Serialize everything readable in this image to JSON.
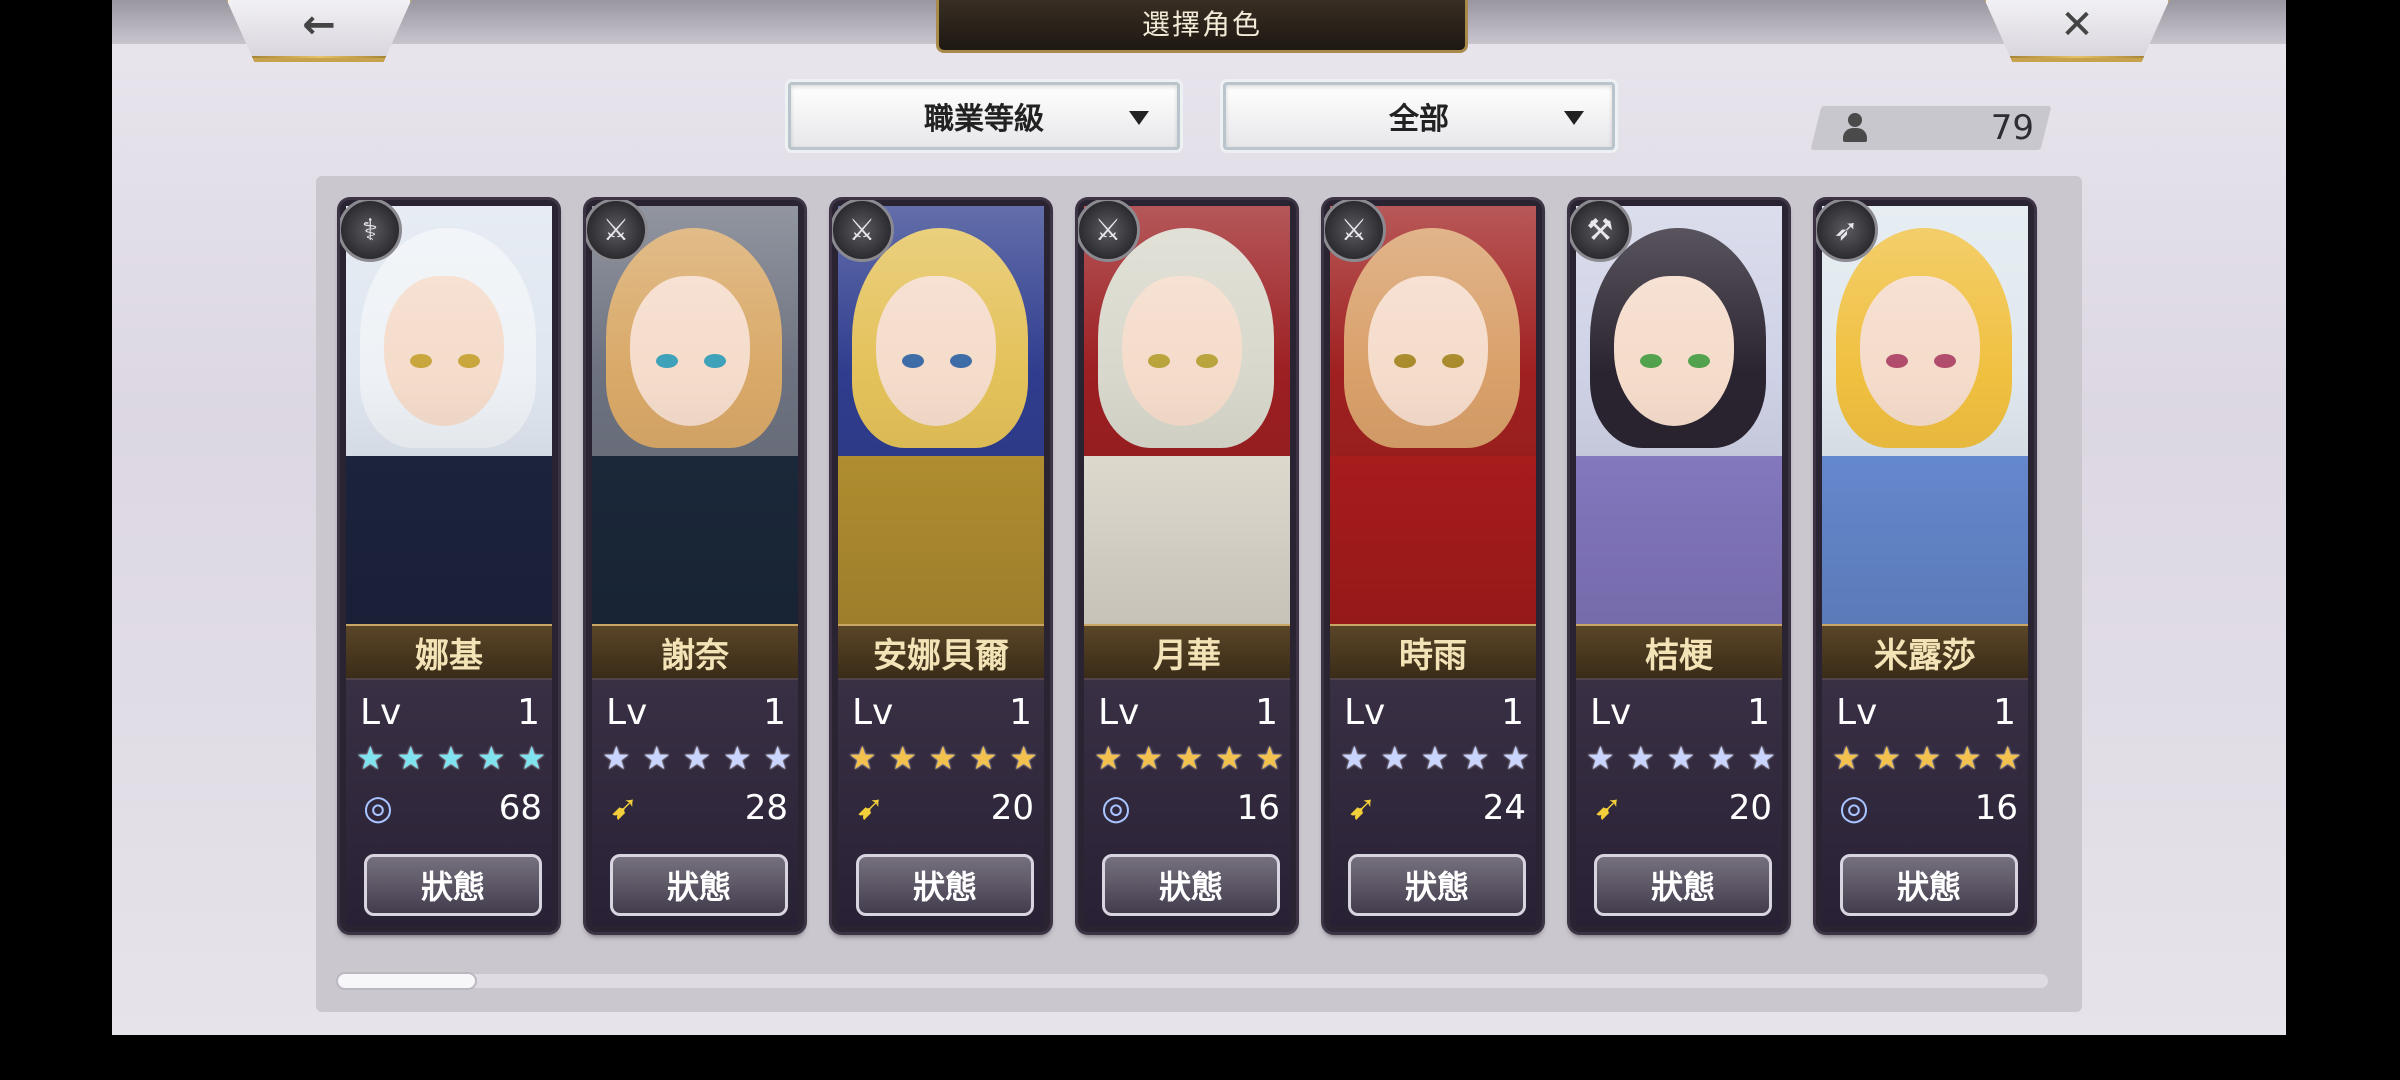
{
  "header": {
    "title": "選擇角色",
    "back_icon": "back-arrow-icon",
    "close_icon": "close-icon"
  },
  "filters": {
    "job_level": "職業等級",
    "category": "全部"
  },
  "roster_count": "79",
  "characters": [
    {
      "name": "娜基",
      "lv_label": "Lv",
      "lv": "1",
      "stars": 5,
      "star_color": "#7fe3f0",
      "element": "wind",
      "element_icon": "swirl-icon",
      "power": "68",
      "status": "狀態",
      "class_icon": "staff-icon"
    },
    {
      "name": "謝奈",
      "lv_label": "Lv",
      "lv": "1",
      "stars": 5,
      "star_color": "#c9d4ff",
      "element": "light",
      "element_icon": "wing-icon",
      "power": "28",
      "status": "狀態",
      "class_icon": "sword-icon"
    },
    {
      "name": "安娜貝爾",
      "lv_label": "Lv",
      "lv": "1",
      "stars": 5,
      "star_color": "#f2c14e",
      "element": "light",
      "element_icon": "wing-icon",
      "power": "20",
      "status": "狀態",
      "class_icon": "sword-icon"
    },
    {
      "name": "月華",
      "lv_label": "Lv",
      "lv": "1",
      "stars": 5,
      "star_color": "#f2c14e",
      "element": "wind",
      "element_icon": "swirl-icon",
      "power": "16",
      "status": "狀態",
      "class_icon": "katana-icon"
    },
    {
      "name": "時雨",
      "lv_label": "Lv",
      "lv": "1",
      "stars": 5,
      "star_color": "#c9d4ff",
      "element": "light",
      "element_icon": "wing-icon",
      "power": "24",
      "status": "狀態",
      "class_icon": "katana-icon"
    },
    {
      "name": "桔梗",
      "lv_label": "Lv",
      "lv": "1",
      "stars": 5,
      "star_color": "#c9d4ff",
      "element": "light",
      "element_icon": "wing-icon",
      "power": "20",
      "status": "狀態",
      "class_icon": "axe-icon"
    },
    {
      "name": "米露莎",
      "lv_label": "Lv",
      "lv": "1",
      "stars": 5,
      "star_color": "#f2c14e",
      "element": "wind",
      "element_icon": "swirl-icon",
      "power": "16",
      "status": "狀態",
      "class_icon": "spear-icon"
    }
  ],
  "scroll_position": 0.08
}
